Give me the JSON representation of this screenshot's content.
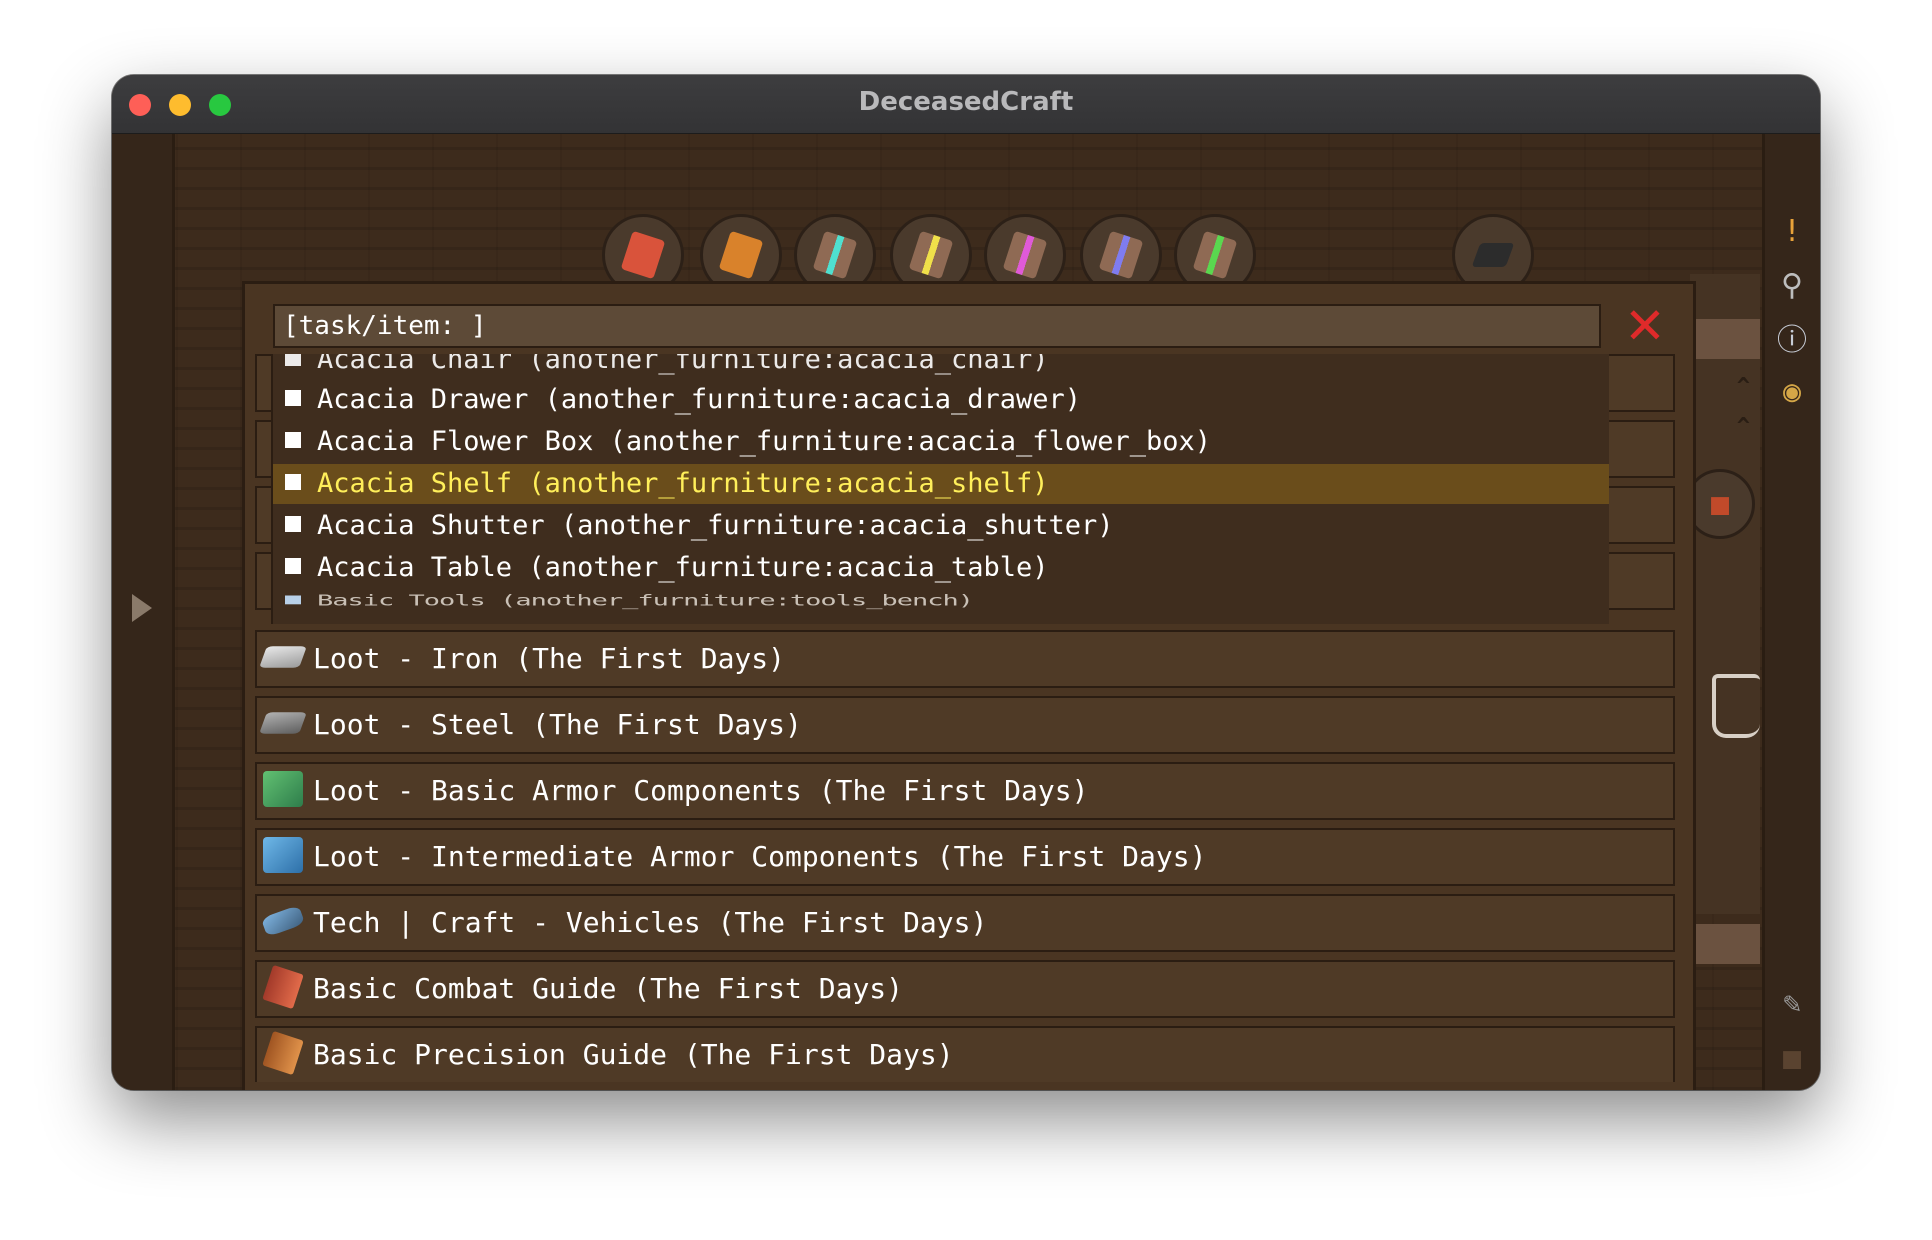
{
  "window": {
    "title": "DeceasedCraft"
  },
  "chapter_bar": {
    "icons": [
      {
        "name": "chapter-book-red-icon",
        "color": "#d9533b",
        "stripe": "#f2c6b2"
      },
      {
        "name": "chapter-book-orange-icon",
        "color": "#d9822b",
        "stripe": "#f7d59a"
      },
      {
        "name": "chapter-book-teal-icon",
        "color": "#8f6a54",
        "stripe": "#4fe0d0"
      },
      {
        "name": "chapter-book-yellow-icon",
        "color": "#8f6a54",
        "stripe": "#f0e04a"
      },
      {
        "name": "chapter-book-pink-icon",
        "color": "#8f6a54",
        "stripe": "#e05ad8"
      },
      {
        "name": "chapter-book-blue-icon",
        "color": "#8f6a54",
        "stripe": "#7f7cf0"
      },
      {
        "name": "chapter-book-green-icon",
        "color": "#8f6a54",
        "stripe": "#5ad84f"
      }
    ]
  },
  "search": {
    "value": "[task/item: ]"
  },
  "close_label": "✕",
  "dropdown": {
    "partial_top": "Acacia Chair (another_furniture:acacia_chair)",
    "items": [
      {
        "label": "Acacia Drawer (another_furniture:acacia_drawer)",
        "selected": false
      },
      {
        "label": "Acacia Flower Box (another_furniture:acacia_flower_box)",
        "selected": false
      },
      {
        "label": "Acacia Shelf (another_furniture:acacia_shelf)",
        "selected": true
      },
      {
        "label": "Acacia Shutter (another_furniture:acacia_shutter)",
        "selected": false
      },
      {
        "label": "Acacia Table (another_furniture:acacia_table)",
        "selected": false
      }
    ],
    "partial_bottom": "Basic Tools (another_furniture:tools_bench)"
  },
  "quests": [
    {
      "label": "Loot - Iron (The First Days)",
      "icon": "iron-ingot-icon"
    },
    {
      "label": "Loot - Steel (The First Days)",
      "icon": "steel-ingot-icon"
    },
    {
      "label": "Loot - Basic Armor Components (The First Days)",
      "icon": "armor-components-basic-icon"
    },
    {
      "label": "Loot - Intermediate Armor Components (The First Days)",
      "icon": "armor-components-intermediate-icon"
    },
    {
      "label": "Tech | Craft - Vehicles (The First Days)",
      "icon": "vehicle-part-icon"
    },
    {
      "label": "Basic Combat Guide (The First Days)",
      "icon": "combat-guide-book-icon"
    },
    {
      "label": "Basic Precision Guide (The First Days)",
      "icon": "precision-guide-book-icon"
    }
  ],
  "colors": {
    "panel_bg": "#4a3522",
    "selected_highlight": "#6a4d1b",
    "selected_text": "#ffef5a",
    "close_red": "#e02a2a"
  }
}
